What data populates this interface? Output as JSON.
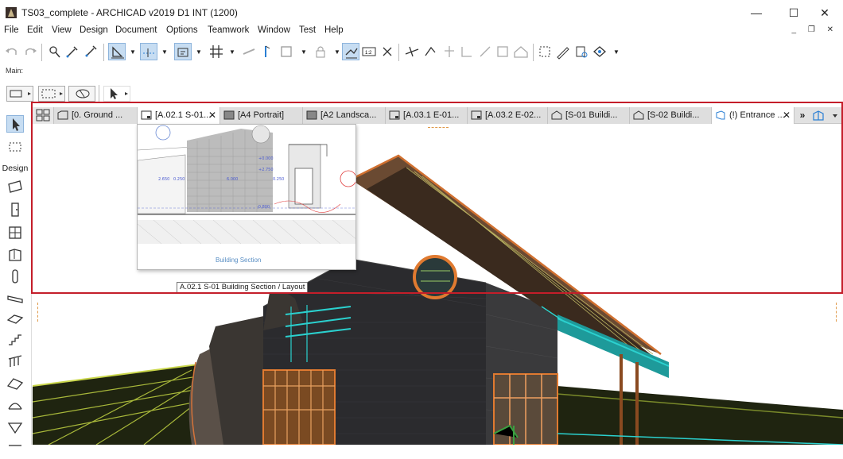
{
  "window": {
    "title": "TS03_complete - ARCHICAD v2019 D1 INT (1200)",
    "controls": [
      "—",
      "☐",
      "✕"
    ]
  },
  "menu": [
    "File",
    "Edit",
    "View",
    "Design",
    "Document",
    "Options",
    "Teamwork",
    "Window",
    "Test",
    "Help"
  ],
  "doc_controls": "_ ❐ ✕",
  "toolbar": {
    "main_label": "Main:"
  },
  "toolbox": {
    "section_label": "Design"
  },
  "tabs": [
    {
      "label": "[0. Ground ...",
      "icon": "floor-plan-icon"
    },
    {
      "label": "[A.02.1 S-01...",
      "icon": "layout-icon",
      "close": "✕",
      "active": true
    },
    {
      "label": "[A4 Portrait]",
      "icon": "master-layout-icon"
    },
    {
      "label": "[A2 Landsca...",
      "icon": "master-layout-icon"
    },
    {
      "label": "[A.03.1 E-01...",
      "icon": "layout-icon"
    },
    {
      "label": "[A.03.2 E-02...",
      "icon": "layout-icon"
    },
    {
      "label": "[S-01 Buildi...",
      "icon": "section-icon"
    },
    {
      "label": "[S-02 Buildi...",
      "icon": "section-icon"
    },
    {
      "label": "(!) Entrance ...",
      "icon": "3d-view-icon",
      "close": "✕",
      "current": true
    }
  ],
  "tab_overflow": "»",
  "preview": {
    "caption": "Building Section",
    "dims": [
      "2.650",
      "0.250",
      "6.000",
      "0.250",
      "+2.750",
      "+0.000",
      "-0.800"
    ]
  },
  "tooltip": "A.02.1 S-01 Building Section / Layout",
  "colors": {
    "highlight_frame": "#c41e2a",
    "selected_tool": "#c7ddf2"
  }
}
